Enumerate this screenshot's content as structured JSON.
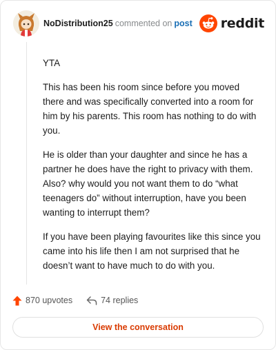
{
  "header": {
    "username": "NoDistribution25",
    "action_text": "commented on",
    "post_link": "post",
    "brand": "reddit"
  },
  "comment": {
    "paragraphs": [
      "YTA",
      "This has been his room since before you moved there and was specifically converted into a room for him by his parents. This room has nothing to do with you.",
      "He is older than your daughter and since he has a partner he does have the right to privacy with them. Also? why would you not want them to do “what teenagers do” without interruption, have you been wanting to interrupt them?",
      "If you have been playing favourites like this since you came into his life then I am not surprised that he doesn’t want to have much to do with you."
    ]
  },
  "actions": {
    "upvotes": "870 upvotes",
    "replies": "74 replies"
  },
  "footer": {
    "button_label": "View the conversation"
  },
  "colors": {
    "reddit_orange": "#ff4500",
    "link_blue": "#1a6fb5",
    "button_text": "#d93a00"
  },
  "icons": [
    "avatar",
    "reddit-logo-icon",
    "upvote-arrow-icon",
    "reply-arrow-icon"
  ]
}
